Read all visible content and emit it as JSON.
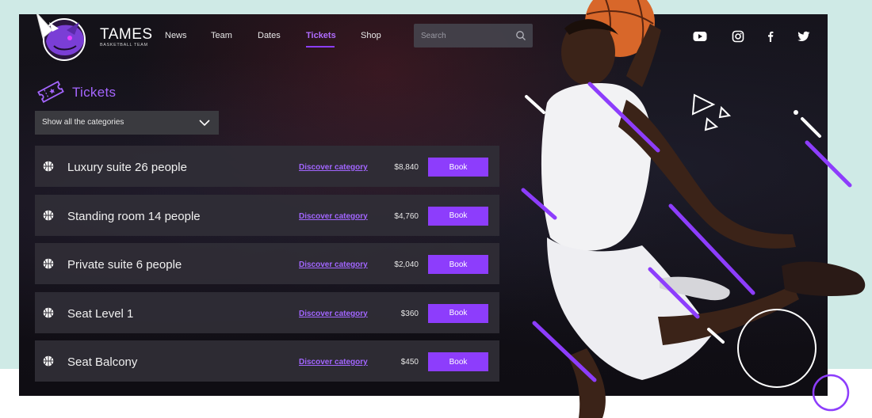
{
  "brand": {
    "name": "TAMES",
    "subtitle": "BASKETBALL TEAM"
  },
  "nav": {
    "items": [
      {
        "label": "News",
        "active": false
      },
      {
        "label": "Team",
        "active": false
      },
      {
        "label": "Dates",
        "active": false
      },
      {
        "label": "Tickets",
        "active": true
      },
      {
        "label": "Shop",
        "active": false
      }
    ]
  },
  "search": {
    "placeholder": "Search",
    "value": ""
  },
  "social": [
    "youtube-icon",
    "instagram-icon",
    "facebook-icon",
    "twitter-icon"
  ],
  "tickets": {
    "title": "Tickets",
    "category_select": "Show all the categories",
    "rows": [
      {
        "label": "Luxury suite 26 people",
        "link": "Discover category",
        "price": "$8,840",
        "button": "Book"
      },
      {
        "label": "Standing room 14 people",
        "link": "Discover category",
        "price": "$4,760",
        "button": "Book"
      },
      {
        "label": "Private suite 6 people",
        "link": "Discover category",
        "price": "$2,040",
        "button": "Book"
      },
      {
        "label": "Seat Level 1",
        "link": "Discover category",
        "price": "$360",
        "button": "Book"
      },
      {
        "label": "Seat Balcony",
        "link": "Discover category",
        "price": "$450",
        "button": "Book"
      }
    ]
  },
  "colors": {
    "accent": "#8d3dfc",
    "accent_text": "#a566ff",
    "background": "#141219",
    "page_bg": "#cfeae6"
  }
}
